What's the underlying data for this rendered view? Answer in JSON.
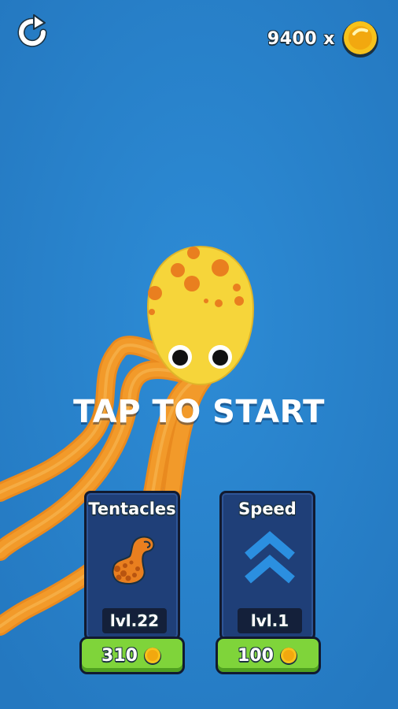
{
  "hud": {
    "coins_label": "9400 x",
    "restart_icon": "restart-icon",
    "coin_icon": "coin-icon"
  },
  "prompt": {
    "tap_to_start": "TAP TO START"
  },
  "upgrades": [
    {
      "title": "Tentacles",
      "level": "lvl.22",
      "price": "310",
      "icon": "tentacle-icon"
    },
    {
      "title": "Speed",
      "level": "lvl.1",
      "price": "100",
      "icon": "double-chevron-up-icon"
    }
  ],
  "colors": {
    "background": "#2a86cf",
    "octopus_body": "#f6d53a",
    "octopus_spots": "#e97f1f",
    "tentacle": "#f29a2a",
    "card": "#1f3f78",
    "button": "#7fd43a",
    "coin": "#f7c21b"
  }
}
